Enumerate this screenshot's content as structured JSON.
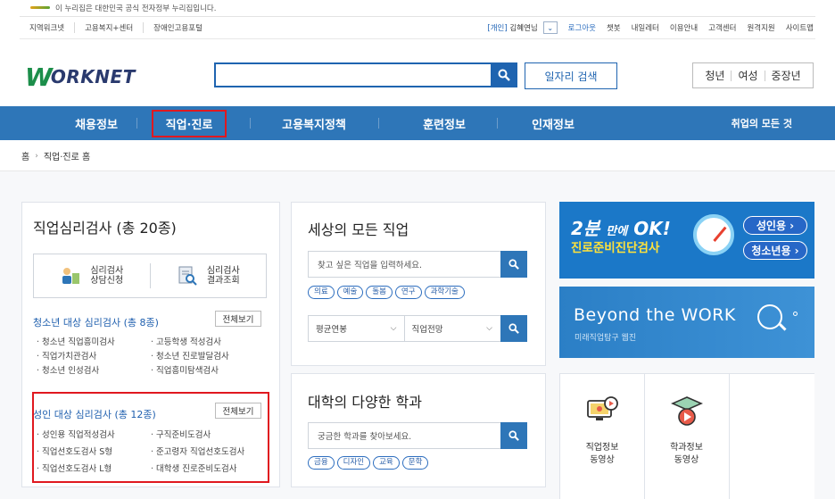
{
  "gov_banner": "이 누리집은 대한민국 공식 전자정부 누리집입니다.",
  "util": {
    "left": [
      "지역워크넷",
      "고용복지+센터",
      "장애인고용포털"
    ],
    "user_type": "[개인]",
    "user_name": "김혜연님",
    "login": "로그아웃",
    "right": [
      "챗봇",
      "내일레터",
      "이용안내",
      "고객센터",
      "원격지원",
      "사이트맵"
    ]
  },
  "logo": {
    "w": "W",
    "text": "ORKNET"
  },
  "search": {
    "placeholder": "",
    "job_search": "일자리 검색"
  },
  "demographics": [
    "청년",
    "여성",
    "중장년"
  ],
  "gnb": {
    "items": [
      "채용정보",
      "직업·진로",
      "고용복지정책",
      "훈련정보",
      "인재정보"
    ],
    "right": "취업의 모든 것"
  },
  "breadcrumb": {
    "home": "홈",
    "current": "직업·진로 홈"
  },
  "psy": {
    "title": "직업심리검사 (총 20종)",
    "link1": "심리검사\n상담신청",
    "link2": "심리검사\n결과조회",
    "youth_title": "청소년 대상 심리검사 (총 8종)",
    "view_all": "전체보기",
    "youth_tests": [
      "청소년 직업흥미검사",
      "고등학생 적성검사",
      "직업가치관검사",
      "청소년 진로발달검사",
      "청소년 인성검사",
      "직업흥미탐색검사"
    ],
    "adult_title": "성인 대상 심리검사 (총 12종)",
    "adult_tests": [
      "성인용 직업적성검사",
      "구직준비도검사",
      "직업선호도검사 S형",
      "준고령자 직업선호도검사",
      "직업선호도검사 L형",
      "대학생 진로준비도검사"
    ]
  },
  "world": {
    "title": "세상의 모든 직업",
    "placeholder": "찾고 싶은 직업을 입력하세요.",
    "tags": [
      "의료",
      "예술",
      "돌봄",
      "연구",
      "과학기술"
    ],
    "select1": "평균연봉",
    "select2": "직업전망"
  },
  "dept": {
    "title": "대학의 다양한 학과",
    "placeholder": "궁금한 학과를 찾아보세요.",
    "tags": [
      "금융",
      "디자인",
      "교육",
      "문학"
    ]
  },
  "banner1": {
    "main_big": "2분",
    "main_small": "만에",
    "main_ok": "OK!",
    "sub": "진로준비진단검사",
    "pill1": "성인용 ›",
    "pill2": "청소년용 ›"
  },
  "banner2": {
    "title": "Beyond the WORK",
    "sub": "미래직업탐구 웹진"
  },
  "videos": [
    {
      "label": "직업정보\n동영상",
      "icon": "monitor-play-icon"
    },
    {
      "label": "학과정보\n동영상",
      "icon": "graduation-play-icon"
    }
  ],
  "colors": {
    "primary": "#2e76b8",
    "highlight": "#e0181f",
    "link": "#1f5fae",
    "banner_yellow": "#ffe23b"
  }
}
